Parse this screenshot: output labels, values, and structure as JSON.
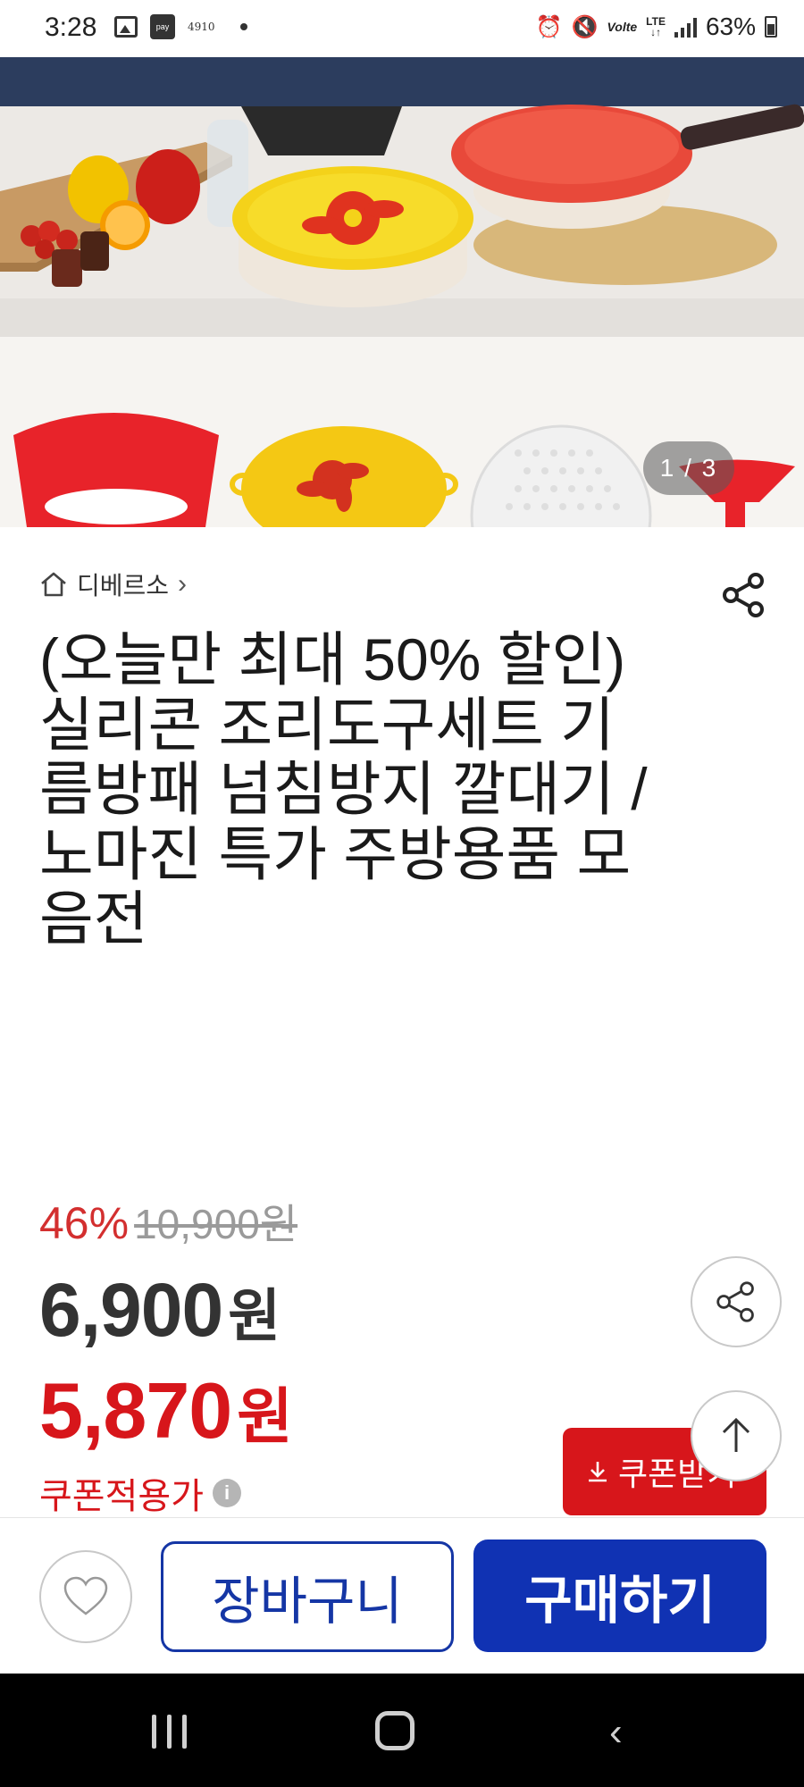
{
  "status_bar": {
    "time": "3:28",
    "notification_number": "4910",
    "battery": "63%",
    "volte": "Volte",
    "network": "LTE"
  },
  "gallery": {
    "counter": "1 / 3"
  },
  "brand": {
    "name": "디베르소",
    "chevron": "›"
  },
  "product": {
    "title": "(오늘만 최대 50% 할인) 실리콘 조리도구세트 기름방패 넘침방지 깔대기 / 노마진 특가 주방용품 모음전",
    "discount_rate": "46%",
    "original_price": "10,900원",
    "price": "6,900",
    "price_unit": "원",
    "coupon_price": "5,870",
    "coupon_price_unit": "원",
    "coupon_price_label": "쿠폰적용가",
    "info_icon_text": "i"
  },
  "coupon_button": {
    "label": "쿠폰받기"
  },
  "actions": {
    "cart_label": "장바구니",
    "buy_label": "구매하기"
  },
  "colors": {
    "sale_red": "#d7161b",
    "buy_blue": "#1032b3",
    "cart_border": "#1536a5"
  }
}
